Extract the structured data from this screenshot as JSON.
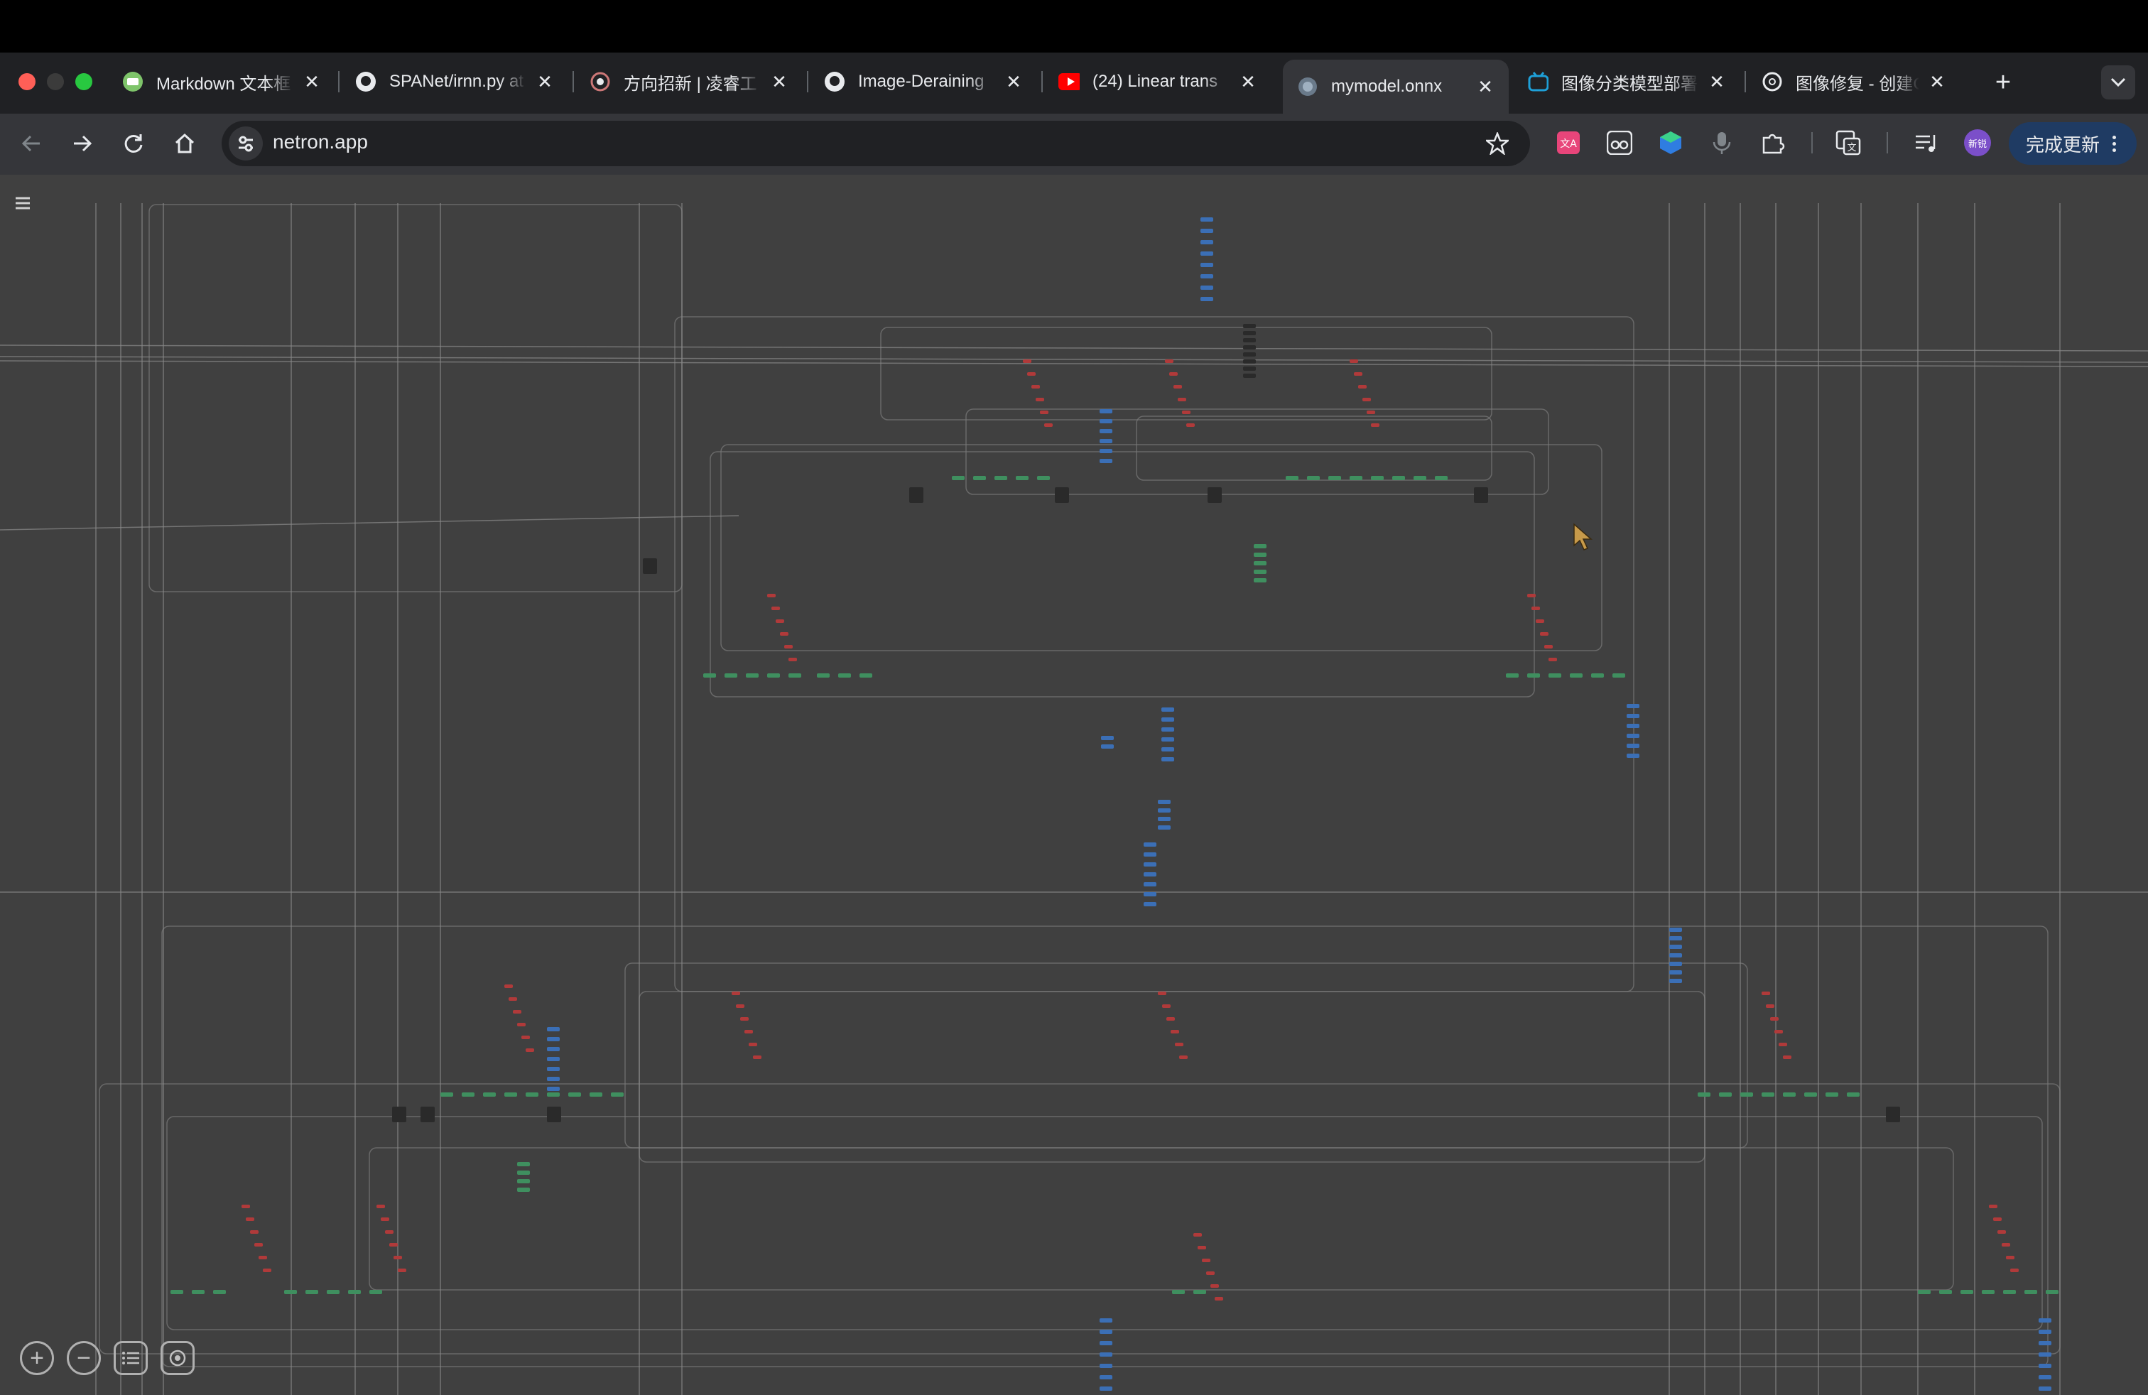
{
  "browser": {
    "tabs": [
      {
        "title": "Markdown 文本框",
        "favicon": "markdown-icon",
        "active": false
      },
      {
        "title": "SPANet/irnn.py at",
        "favicon": "github-icon",
        "active": false
      },
      {
        "title": "方向招新 | 凌睿工",
        "favicon": "circle-logo-icon",
        "active": false
      },
      {
        "title": "Image-Deraining",
        "favicon": "github-icon",
        "active": false
      },
      {
        "title": "(24) Linear trans",
        "favicon": "youtube-icon",
        "active": false
      },
      {
        "title": "mymodel.onnx",
        "favicon": "netron-icon",
        "active": true
      },
      {
        "title": "图像分类模型部署",
        "favicon": "bilibili-icon",
        "active": false
      },
      {
        "title": "图像修复 - 创建C",
        "favicon": "openai-icon",
        "active": false
      }
    ],
    "url": "netron.app",
    "update_button": "完成更新",
    "new_tab_glyph": "+",
    "profile_badge": "新锐"
  },
  "colors": {
    "canvas": "#404040",
    "edge": "#8a8a8a",
    "node_blue": "#3b6fb6",
    "node_green": "#3f8f5f",
    "node_red": "#b03a3a",
    "node_dark": "#2a2a2a"
  },
  "zoom_controls": [
    "zoom-in-icon",
    "zoom-out-icon",
    "list-icon",
    "target-icon"
  ]
}
